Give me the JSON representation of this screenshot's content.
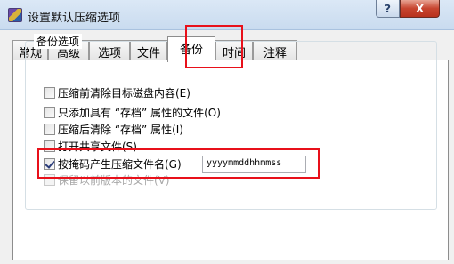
{
  "window": {
    "title": "设置默认压缩选项",
    "help_label": "?",
    "close_label": "X"
  },
  "tabs": [
    {
      "label": "常规"
    },
    {
      "label": "高级"
    },
    {
      "label": "选项"
    },
    {
      "label": "文件"
    },
    {
      "label": "备份"
    },
    {
      "label": "时间"
    },
    {
      "label": "注释"
    }
  ],
  "active_tab": "备份",
  "group": {
    "title": "备份选项",
    "options": [
      {
        "label": "压缩前清除目标磁盘内容(E)",
        "checked": false,
        "enabled": true
      },
      {
        "label": "只添加具有 “存档” 属性的文件(O)",
        "checked": false,
        "enabled": true
      },
      {
        "label": "压缩后清除 “存档” 属性(I)",
        "checked": false,
        "enabled": true
      },
      {
        "label": "打开共享文件(S)",
        "checked": false,
        "enabled": true
      },
      {
        "label": "按掩码产生压缩文件名(G)",
        "checked": true,
        "enabled": true
      },
      {
        "label": "保留以前版本的文件(V)",
        "checked": false,
        "enabled": false
      }
    ]
  },
  "filename_mask": {
    "value": "yyyymmddhhmmss"
  },
  "highlight_color": "#e8101a"
}
